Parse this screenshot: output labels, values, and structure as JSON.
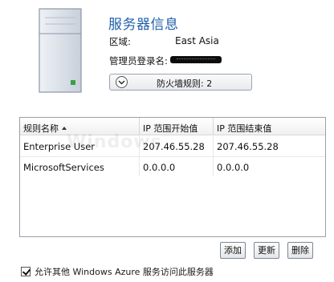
{
  "header": {
    "title": "服务器信息",
    "region_label": "区域:",
    "region_value": "East Asia",
    "admin_label": "管理员登录名:"
  },
  "firewall": {
    "button_label": "防火墙规则: 2",
    "expand_icon": "chevron-down-icon"
  },
  "table": {
    "columns": [
      "规则名称",
      "IP 范围开始值",
      "IP 范围结束值"
    ],
    "sort_icon": "sort-ascending-icon",
    "rows": [
      {
        "name": "Enterprise User",
        "start": "207.46.55.28",
        "end": "207.46.55.28"
      },
      {
        "name": "MicrosoftServices",
        "start": "0.0.0.0",
        "end": "0.0.0.0"
      }
    ]
  },
  "watermark": "Windows",
  "actions": {
    "add": "添加",
    "update": "更新",
    "delete": "删除"
  },
  "allow_checkbox": {
    "label": "允许其他 Windows Azure 服务访问此服务器",
    "checked": true
  },
  "colors": {
    "title": "#1f5fa8",
    "server_accent": "#3aa047"
  }
}
